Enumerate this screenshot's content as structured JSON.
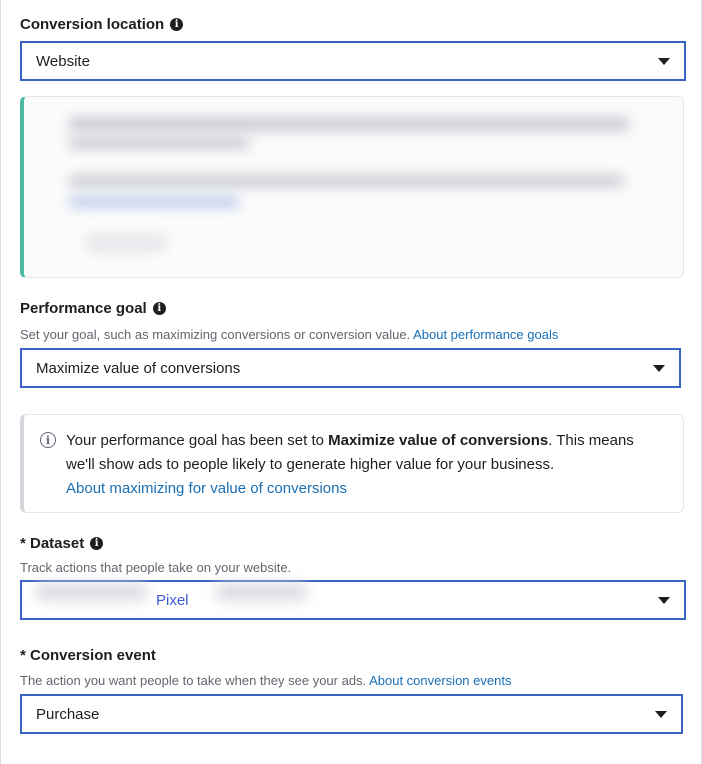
{
  "conversion_location": {
    "label": "Conversion location",
    "value": "Website"
  },
  "performance_goal": {
    "label": "Performance goal",
    "helper": "Set your goal, such as maximizing conversions or conversion value.",
    "helper_link": "About performance goals",
    "value": "Maximize value of conversions"
  },
  "info_notice": {
    "text_before": "Your performance goal has been set to ",
    "bold": "Maximize value of conversions",
    "text_after": ". This means we'll show ads to people likely to generate higher value for your business.",
    "link": "About maximizing for value of conversions"
  },
  "dataset": {
    "label": "* Dataset",
    "helper": "Track actions that people take on your website.",
    "value": "Pixel"
  },
  "conversion_event": {
    "label": "* Conversion event",
    "helper": "The action you want people to take when they see your ads.",
    "helper_link": "About conversion events",
    "value": "Purchase"
  },
  "colors": {
    "select_border": "#3b63c4",
    "link": "#1a6fb5",
    "card_accent": "#4fb8a0"
  },
  "icons": [
    "info-icon",
    "caret-down-icon",
    "info-circle-icon"
  ]
}
